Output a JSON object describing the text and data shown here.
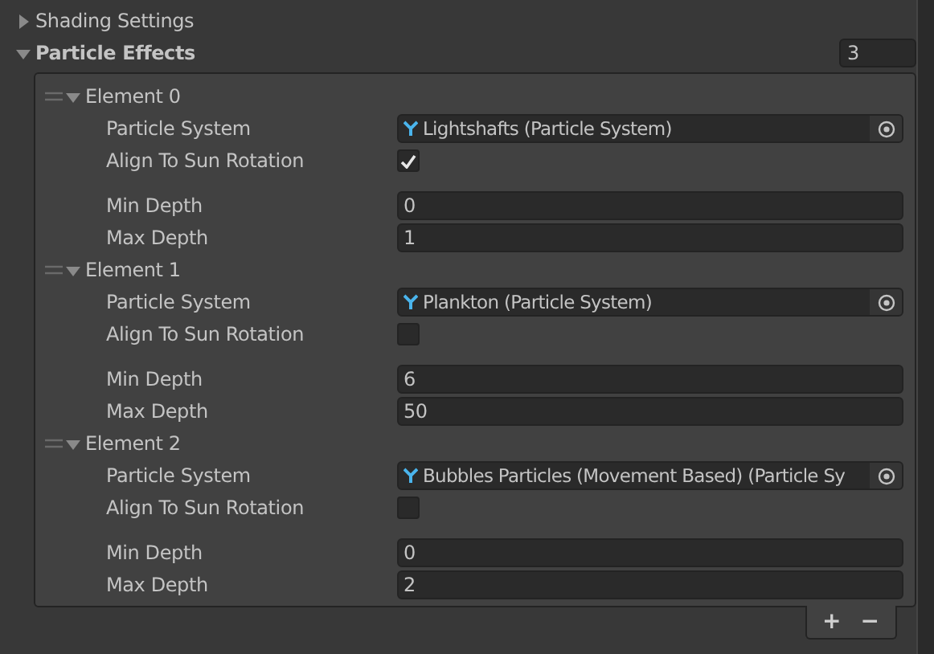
{
  "sections": [
    {
      "label": "Shading Settings",
      "expanded": false
    },
    {
      "label": "Particle Effects",
      "expanded": true,
      "size": "3"
    }
  ],
  "elements": [
    {
      "title": "Element 0",
      "expanded": true,
      "particle_label": "Particle System",
      "particle_value": "Lightshafts (Particle System)",
      "align_label": "Align To Sun Rotation",
      "align_checked": true,
      "min_label": "Min Depth",
      "min_value": "0",
      "max_label": "Max Depth",
      "max_value": "1"
    },
    {
      "title": "Element 1",
      "expanded": true,
      "particle_label": "Particle System",
      "particle_value": "Plankton (Particle System)",
      "align_label": "Align To Sun Rotation",
      "align_checked": false,
      "min_label": "Min Depth",
      "min_value": "6",
      "max_label": "Max Depth",
      "max_value": "50"
    },
    {
      "title": "Element 2",
      "expanded": true,
      "particle_label": "Particle System",
      "particle_value": "Bubbles Particles (Movement Based) (Particle Sy",
      "align_label": "Align To Sun Rotation",
      "align_checked": false,
      "min_label": "Min Depth",
      "min_value": "0",
      "max_label": "Max Depth",
      "max_value": "2"
    }
  ],
  "footer": {
    "add": "+",
    "remove": "−"
  }
}
